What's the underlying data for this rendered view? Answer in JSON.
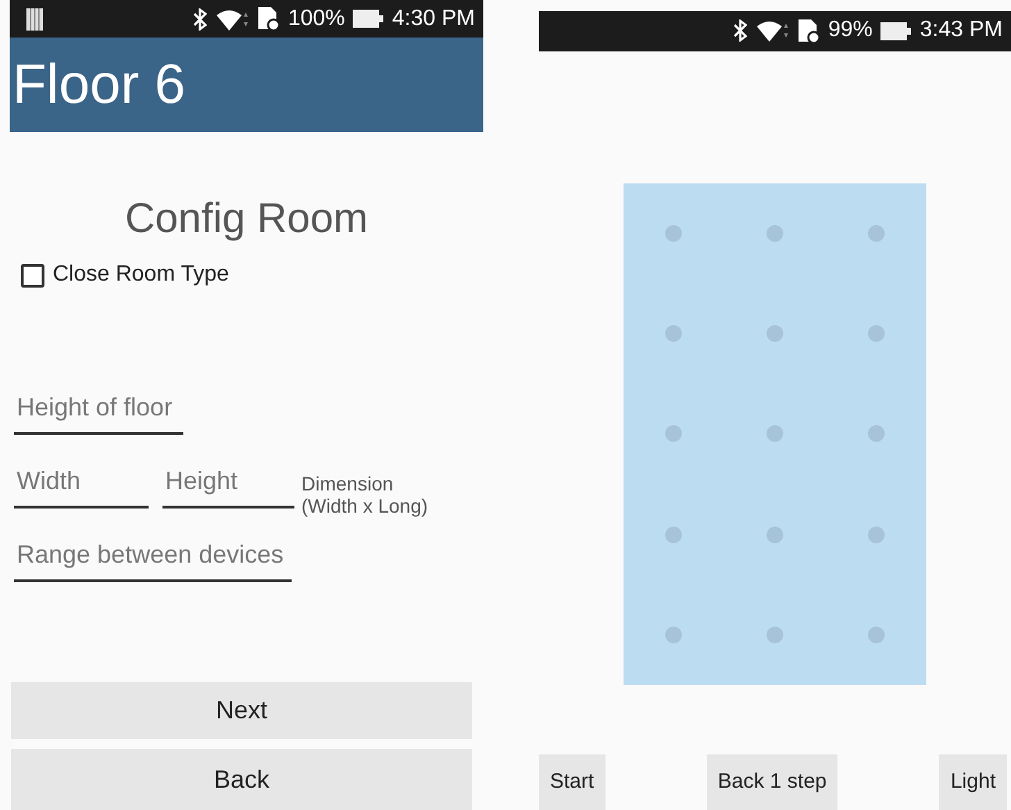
{
  "left_screen": {
    "status_bar": {
      "battery_text": "100%",
      "time": "4:30 PM"
    },
    "title": "Floor 6",
    "heading": "Config Room",
    "checkbox": {
      "label": "Close Room Type",
      "checked": false
    },
    "height_field": {
      "placeholder": "Height of floor"
    },
    "width_field": {
      "placeholder": "Width"
    },
    "length_field": {
      "placeholder": "Height"
    },
    "dimension_note": "Dimension\n(Width x Long)",
    "range_field": {
      "placeholder": "Range between devices"
    },
    "buttons": [
      "Next",
      "Back"
    ]
  },
  "right_screen": {
    "status_bar": {
      "battery_text": "99%",
      "time": "3:43 PM"
    },
    "buttons": [
      "Start",
      "Back 1 step",
      "Light"
    ]
  }
}
